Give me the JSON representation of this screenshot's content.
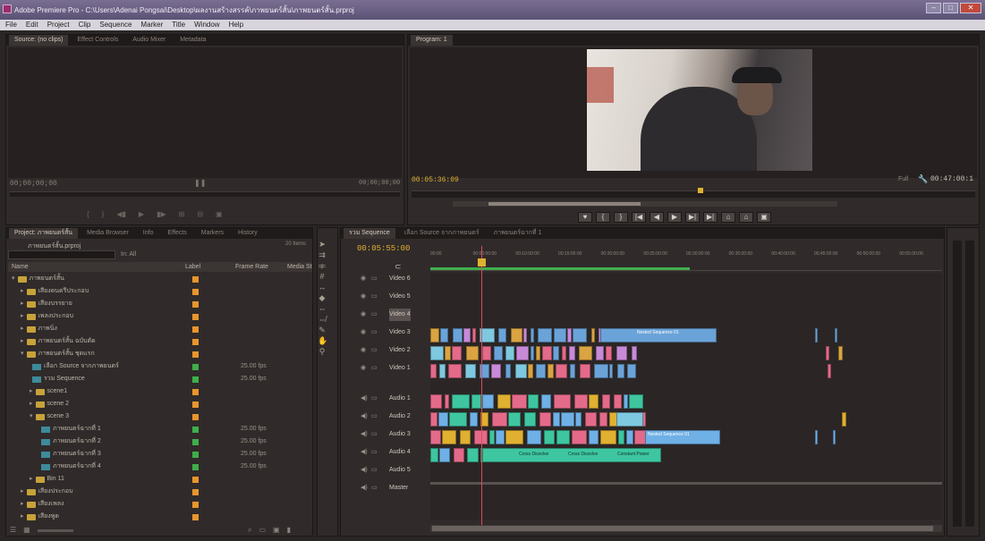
{
  "window": {
    "title": "Adobe Premiere Pro - C:\\Users\\Adenai Pongsai\\Desktop\\ผลงานสร้างสรรค์\\ภาพยนตร์สั้น\\ภาพยนตร์สั้น.prproj"
  },
  "menu": [
    "File",
    "Edit",
    "Project",
    "Clip",
    "Sequence",
    "Marker",
    "Title",
    "Window",
    "Help"
  ],
  "source_monitor": {
    "tabs": [
      "Source: (no clips)",
      "Effect Controls",
      "Audio Mixer",
      "Metadata"
    ],
    "timecode_left": "00;00;00;00",
    "timecode_right": "00;00;00;00"
  },
  "program_monitor": {
    "tab": "Program: 1",
    "timecode": "00:05:36:09",
    "fit": "Full",
    "duration": "00:47:00:1"
  },
  "project": {
    "tabs": [
      "Project: ภาพยนตร์สั้น",
      "Media Browser",
      "Info",
      "Effects",
      "Markers",
      "History"
    ],
    "file": "ภาพยนตร์สั้น.prproj",
    "item_count": "20 Items",
    "search_placeholder": "",
    "in_label": "In: All",
    "columns": {
      "name": "Name",
      "label": "Label",
      "frame_rate": "Frame Rate",
      "media_start": "Media St"
    },
    "rows": [
      {
        "name": "ภาพยนตร์สั้น",
        "type": "folder",
        "indent": 0,
        "open": true,
        "color": "#e8952e",
        "fps": ""
      },
      {
        "name": "เสียงดนตรีประกอบ",
        "type": "folder",
        "indent": 1,
        "open": false,
        "color": "#e8952e",
        "fps": ""
      },
      {
        "name": "เสียงบรรยาย",
        "type": "folder",
        "indent": 1,
        "open": false,
        "color": "#e8952e",
        "fps": ""
      },
      {
        "name": "เพลงประกอบ",
        "type": "folder",
        "indent": 1,
        "open": false,
        "color": "#e8952e",
        "fps": ""
      },
      {
        "name": "ภาพนิ่ง",
        "type": "folder",
        "indent": 1,
        "open": false,
        "color": "#e8952e",
        "fps": ""
      },
      {
        "name": "ภาพยนตร์สั้น ฉบับตัด",
        "type": "folder",
        "indent": 1,
        "open": false,
        "color": "#e8952e",
        "fps": ""
      },
      {
        "name": "ภาพยนตร์สั้น ชุดแรก",
        "type": "folder",
        "indent": 1,
        "open": true,
        "color": "#e8952e",
        "fps": ""
      },
      {
        "name": "เลือก Source จากภาพยนตร์",
        "type": "sequence",
        "indent": 2,
        "open": false,
        "color": "#3fae4b",
        "fps": "25.00 fps"
      },
      {
        "name": "รวม Sequence",
        "type": "sequence",
        "indent": 2,
        "open": false,
        "color": "#3fae4b",
        "fps": "25.00 fps"
      },
      {
        "name": "scene1",
        "type": "folder",
        "indent": 2,
        "open": false,
        "color": "#e8952e",
        "fps": ""
      },
      {
        "name": "scene 2",
        "type": "folder",
        "indent": 2,
        "open": false,
        "color": "#e8952e",
        "fps": ""
      },
      {
        "name": "scene 3",
        "type": "folder",
        "indent": 2,
        "open": true,
        "color": "#e8952e",
        "fps": ""
      },
      {
        "name": "ภาพยนตร์ฉากที่ 1",
        "type": "sequence",
        "indent": 3,
        "open": false,
        "color": "#3fae4b",
        "fps": "25.00 fps"
      },
      {
        "name": "ภาพยนตร์ฉากที่ 2",
        "type": "sequence",
        "indent": 3,
        "open": false,
        "color": "#3fae4b",
        "fps": "25.00 fps"
      },
      {
        "name": "ภาพยนตร์ฉากที่ 3",
        "type": "sequence",
        "indent": 3,
        "open": false,
        "color": "#3fae4b",
        "fps": "25.00 fps"
      },
      {
        "name": "ภาพยนตร์ฉากที่ 4",
        "type": "sequence",
        "indent": 3,
        "open": false,
        "color": "#3fae4b",
        "fps": "25.00 fps"
      },
      {
        "name": "Bin 11",
        "type": "folder",
        "indent": 2,
        "open": false,
        "color": "#e8952e",
        "fps": ""
      },
      {
        "name": "เสียงประกอบ",
        "type": "folder",
        "indent": 1,
        "open": false,
        "color": "#e8952e",
        "fps": ""
      },
      {
        "name": "เสียงเพลง",
        "type": "folder",
        "indent": 1,
        "open": false,
        "color": "#e8952e",
        "fps": ""
      },
      {
        "name": "เสียงพูด",
        "type": "folder",
        "indent": 1,
        "open": false,
        "color": "#e8952e",
        "fps": ""
      }
    ]
  },
  "timeline": {
    "tabs": [
      "รวม Sequence",
      "เลือก Source จากภาพยนตร์",
      "ภาพยนตร์ฉากที่ 1"
    ],
    "timecode": "00:05:55:00",
    "ruler": [
      "00:00",
      "00:05:00:00",
      "00:10:00:00",
      "00:15:00:00",
      "00:20:00:00",
      "00:25:00:00",
      "00:30:00:00",
      "00:35:00:00",
      "00:40:00:00",
      "00:45:00:00",
      "00:50:00:00",
      "00:55:00:00"
    ],
    "tracks": [
      "Video 6",
      "Video 5",
      "Video 4",
      "Video 3",
      "Video 2",
      "Video 1",
      "Audio 1",
      "Audio 2",
      "Audio 3",
      "Audio 4",
      "Audio 5",
      "Master"
    ],
    "clip_labels": [
      "Nested Sequence 01",
      "Nested Sequence 01",
      "Cross Dissolve",
      "Cross Dissolve",
      "Constant Power"
    ]
  },
  "colors": {
    "accent": "#e0b030",
    "playhead": "#e04a5a",
    "video_clip": "#6aa3d8",
    "audio_clip": "#3ec6a0"
  }
}
